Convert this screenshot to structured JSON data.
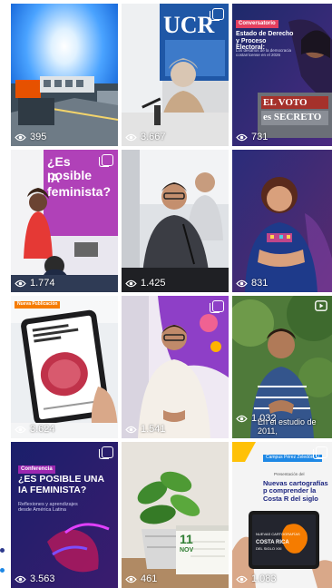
{
  "tiles": [
    {
      "views": "395"
    },
    {
      "views": "3.667",
      "banner": "UCR"
    },
    {
      "views": "731",
      "tag": "Conversatorio",
      "title": "Estado de Derecho y Proceso Electoral:",
      "subtitle": "Los desafíos de la democracia costarricense en el 2026",
      "sign1": "EL VOTO",
      "sign2": "es SECRETO"
    },
    {
      "views": "1.774",
      "slide1": "¿Es posible",
      "slide2": "IA feminista?"
    },
    {
      "views": "1.425"
    },
    {
      "views": "831"
    },
    {
      "views": "3.624",
      "tag": "Nueva Publicación"
    },
    {
      "views": "1.541"
    },
    {
      "views": "1.032",
      "caption": "En el estudio de 2011,"
    },
    {
      "views": "3.563",
      "tag": "Conferencia",
      "title": "¿ES POSIBLE UNA IA FEMINISTA?",
      "subtitle": "Reflexiones y aprendizajes desde América Latina"
    },
    {
      "views": "461",
      "cal_day": "11",
      "cal_month": "NOV"
    },
    {
      "views": "1.083",
      "banner": "Campus Pérez Zeledón, U",
      "pre": "Presentación del",
      "title": "Nuevas cartografías p comprender la Costa R del siglo",
      "book1": "NUEVAS CARTOGRAFÍAS",
      "book2": "COSTA RICA",
      "book3": "DEL SIGLO XXI"
    }
  ],
  "colors": {
    "accent": "#e4405f",
    "overlay_text": "#ffffff"
  }
}
